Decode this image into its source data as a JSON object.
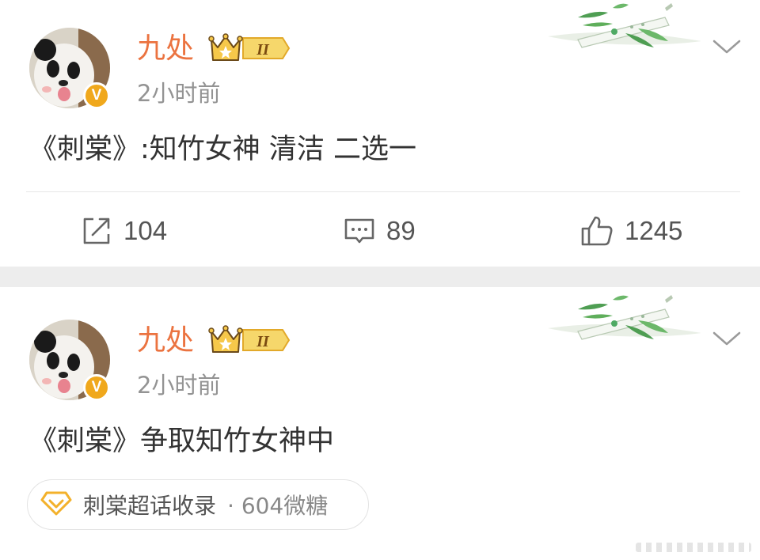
{
  "posts": [
    {
      "username": "九处",
      "vip_level": "II",
      "verified_mark": "V",
      "time": "2小时前",
      "content": "《刺棠》:知竹女神 清洁 二选一",
      "actions": {
        "repost": "104",
        "comment": "89",
        "like": "1245"
      }
    },
    {
      "username": "九处",
      "vip_level": "II",
      "verified_mark": "V",
      "time": "2小时前",
      "content": "《刺棠》争取知竹女神中",
      "topic": {
        "name": "刺棠超话收录",
        "meta": "· 604微糖"
      }
    }
  ],
  "icons": {
    "repost": "share-square-icon",
    "comment": "comment-bubble-icon",
    "like": "thumbs-up-icon",
    "more": "chevron-down-icon",
    "topic": "diamond-icon",
    "vip": "crown-icon",
    "verified": "verified-v-icon",
    "decoration": "bamboo-flute-decoration"
  },
  "colors": {
    "username": "#eb7340",
    "verified_badge": "#f0a81c",
    "vip_badge": "#f2c94c",
    "separator": "#ededed",
    "time": "#939393",
    "text": "#333333"
  }
}
